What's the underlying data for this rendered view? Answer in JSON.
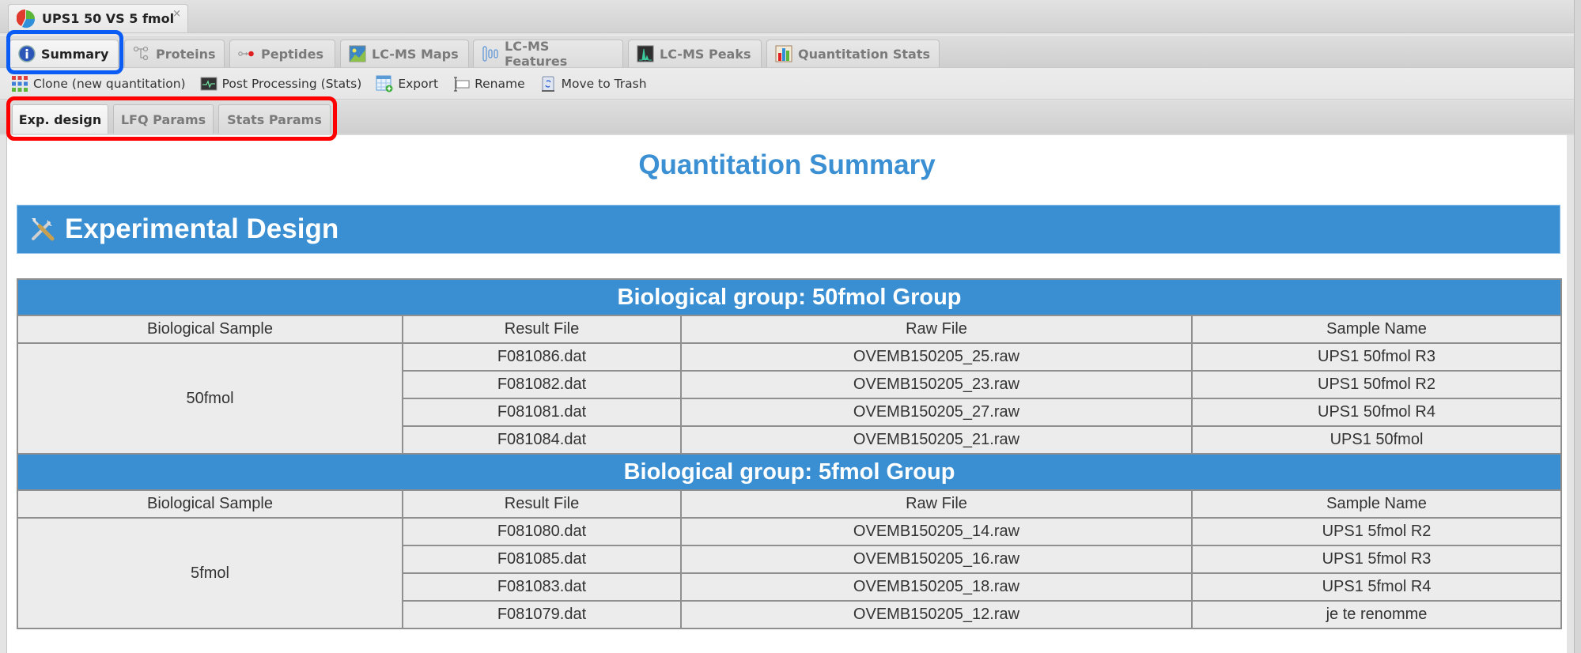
{
  "document_tab": {
    "title": "UPS1 50 VS 5 fmol",
    "close_icon": "×"
  },
  "main_tabs": [
    {
      "label": "Summary",
      "icon": "info-icon",
      "active": true
    },
    {
      "label": "Proteins",
      "icon": "protein-tree-icon",
      "active": false
    },
    {
      "label": "Peptides",
      "icon": "peptide-icon",
      "active": false
    },
    {
      "label": "LC-MS Maps",
      "icon": "map-icon",
      "active": false
    },
    {
      "label": "LC-MS Features",
      "icon": "features-icon",
      "active": false
    },
    {
      "label": "LC-MS Peaks",
      "icon": "peaks-icon",
      "active": false
    },
    {
      "label": "Quantitation Stats",
      "icon": "bar-chart-icon",
      "active": false
    }
  ],
  "toolbar": [
    {
      "label": "Clone (new quantitation)",
      "icon": "grid-icon"
    },
    {
      "label": "Post Processing (Stats)",
      "icon": "monitor-icon"
    },
    {
      "label": "Export",
      "icon": "export-table-icon"
    },
    {
      "label": "Rename",
      "icon": "rename-icon"
    },
    {
      "label": "Move to Trash",
      "icon": "trash-icon"
    }
  ],
  "sub_tabs": [
    {
      "label": "Exp. design",
      "active": true
    },
    {
      "label": "LFQ Params",
      "active": false
    },
    {
      "label": "Stats Params",
      "active": false
    }
  ],
  "page_title": "Quantitation Summary",
  "section_title": "Experimental Design",
  "columns": [
    "Biological Sample",
    "Result File",
    "Raw File",
    "Sample Name"
  ],
  "groups": [
    {
      "title": "Biological group: 50fmol Group",
      "biological_sample": "50fmol",
      "rows": [
        {
          "result_file": "F081086.dat",
          "raw_file": "OVEMB150205_25.raw",
          "sample_name": "UPS1 50fmol R3"
        },
        {
          "result_file": "F081082.dat",
          "raw_file": "OVEMB150205_23.raw",
          "sample_name": "UPS1 50fmol R2"
        },
        {
          "result_file": "F081081.dat",
          "raw_file": "OVEMB150205_27.raw",
          "sample_name": "UPS1 50fmol R4"
        },
        {
          "result_file": "F081084.dat",
          "raw_file": "OVEMB150205_21.raw",
          "sample_name": "UPS1 50fmol"
        }
      ]
    },
    {
      "title": "Biological group: 5fmol Group",
      "biological_sample": "5fmol",
      "rows": [
        {
          "result_file": "F081080.dat",
          "raw_file": "OVEMB150205_14.raw",
          "sample_name": "UPS1 5fmol R2"
        },
        {
          "result_file": "F081085.dat",
          "raw_file": "OVEMB150205_16.raw",
          "sample_name": "UPS1 5fmol R3"
        },
        {
          "result_file": "F081083.dat",
          "raw_file": "OVEMB150205_18.raw",
          "sample_name": "UPS1 5fmol R4"
        },
        {
          "result_file": "F081079.dat",
          "raw_file": "OVEMB150205_12.raw",
          "sample_name": "je te renomme"
        }
      ]
    }
  ],
  "colors": {
    "accent": "#3a8fd3",
    "highlight_blue": "#0a5cf5",
    "highlight_red": "#ff0000"
  }
}
